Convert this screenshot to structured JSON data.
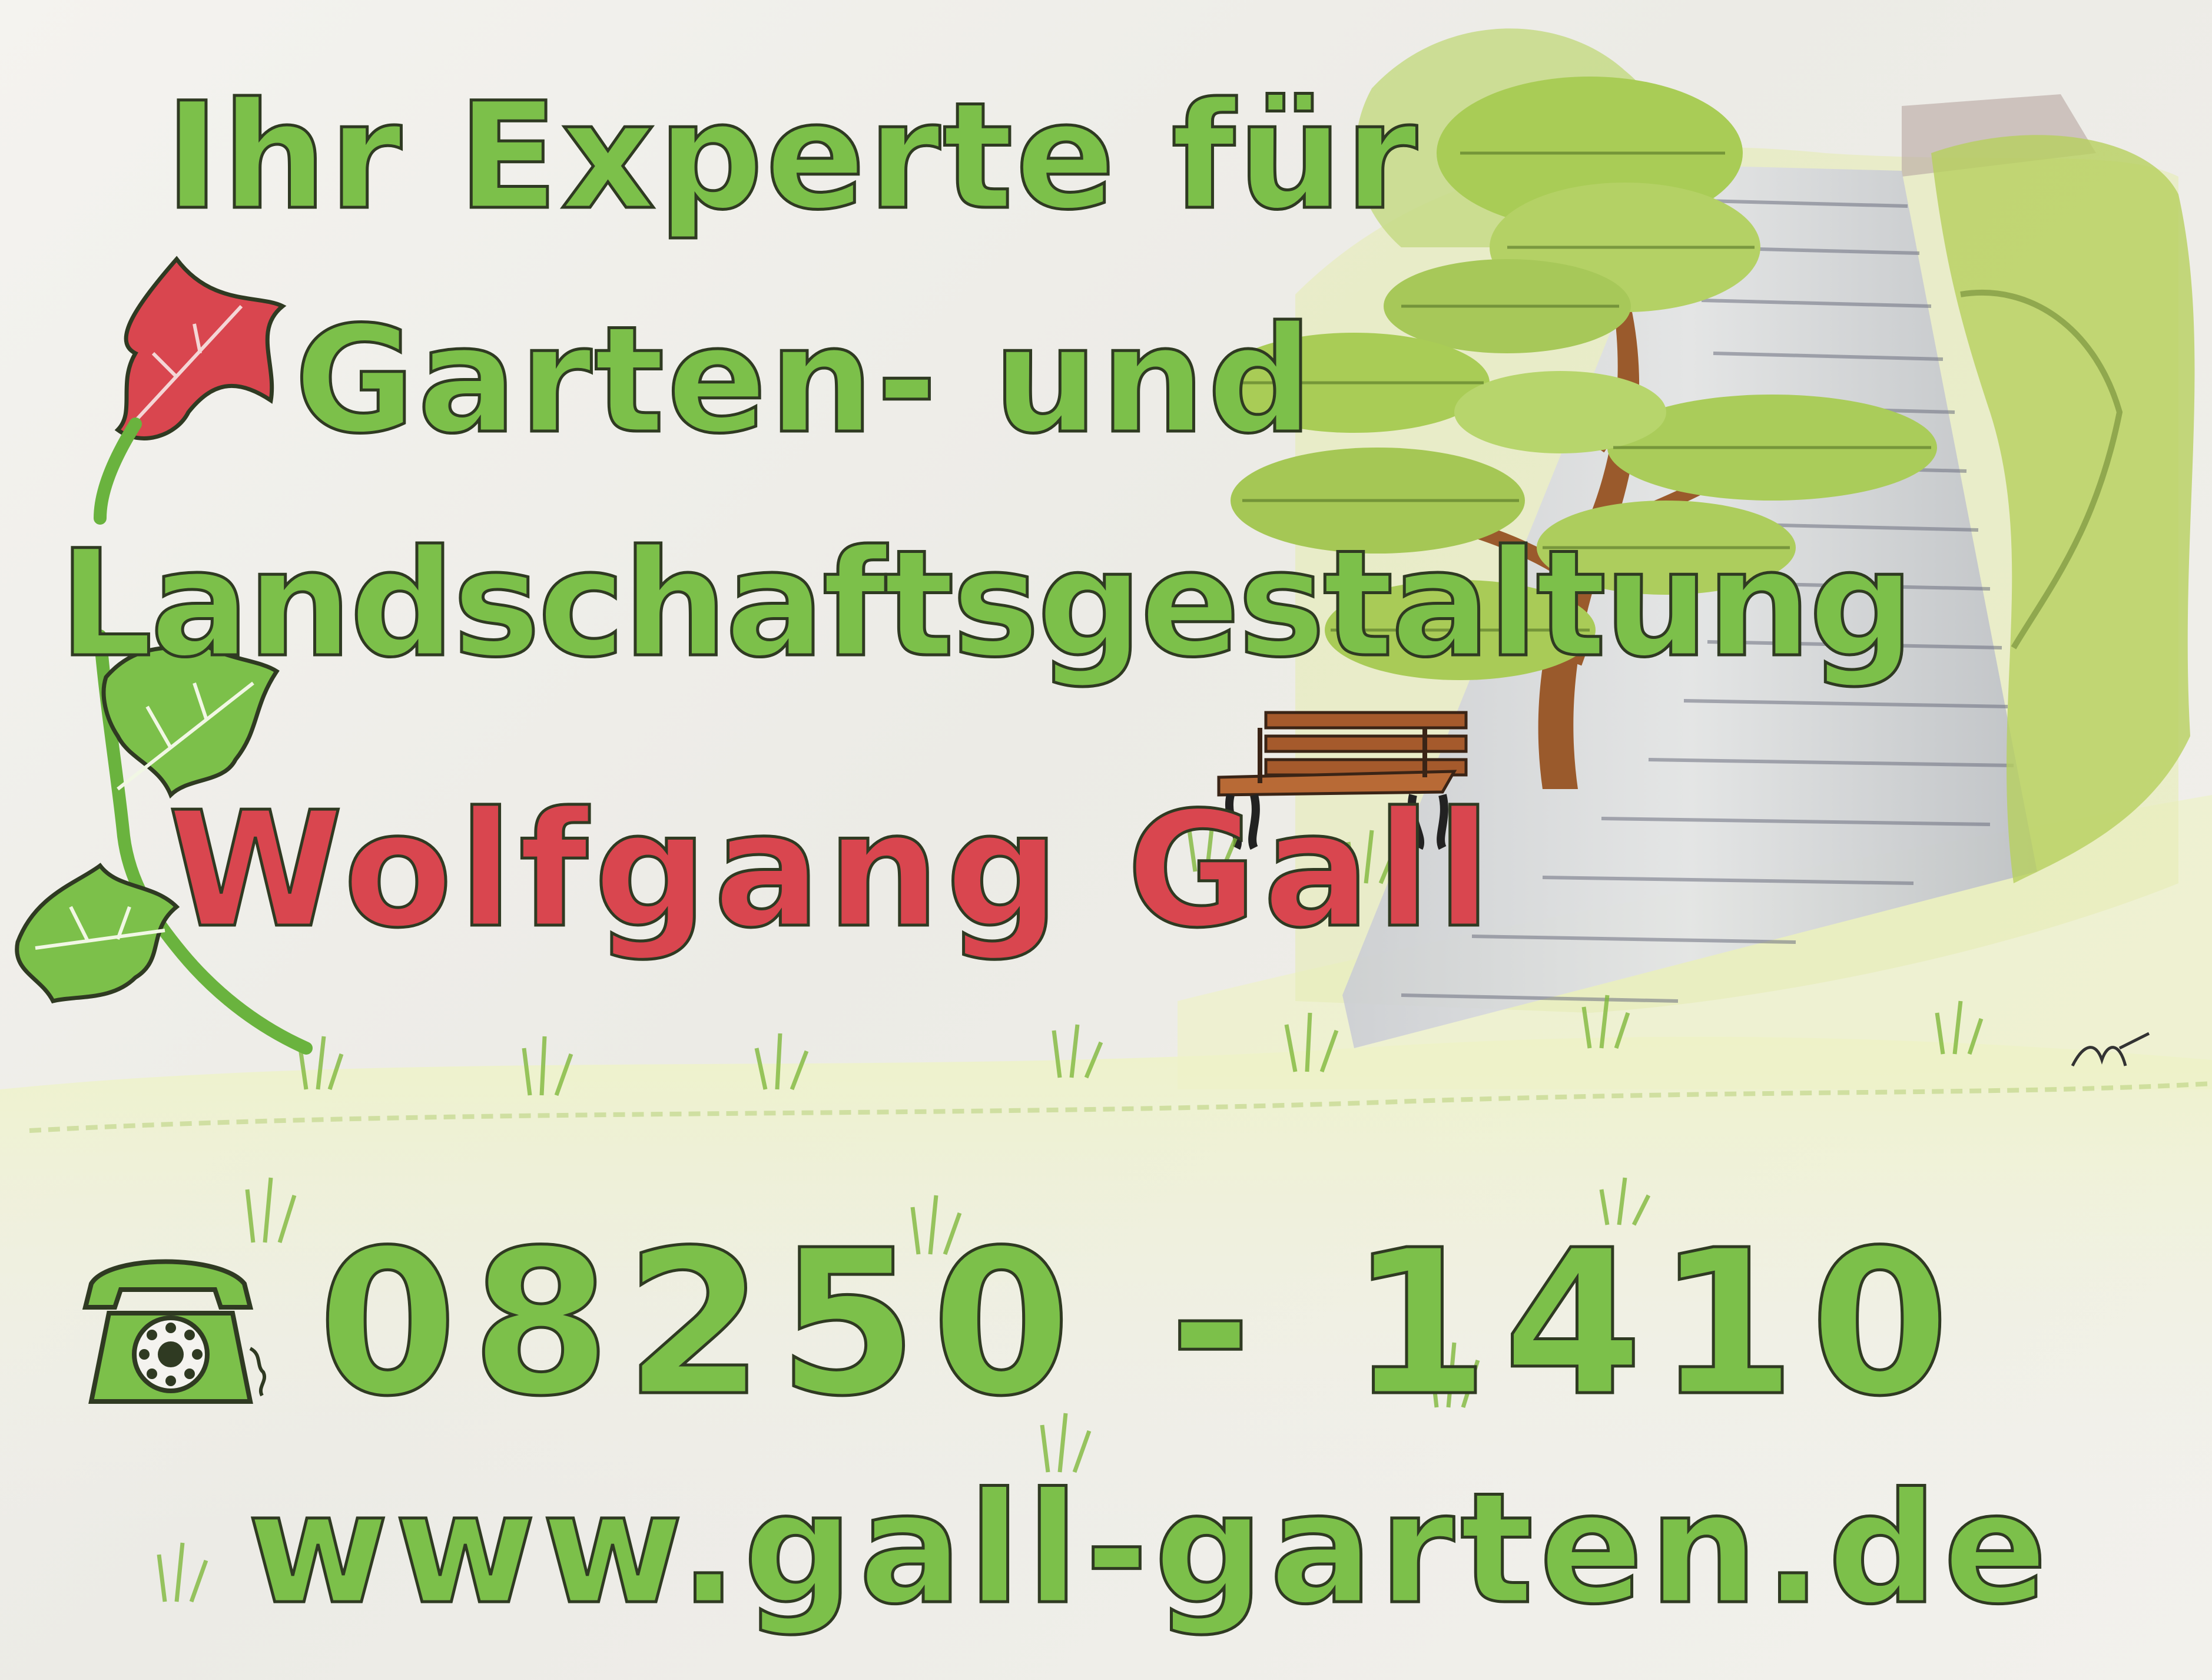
{
  "poster": {
    "headline_line1": "Ihr Experte für",
    "headline_line2": "Garten- und",
    "headline_line3": "Landschaftsgestaltung",
    "owner_name": "Wolfgang Gall",
    "phone_number": "08250 - 1410",
    "website": "www.gall-garten.de",
    "icons": [
      "rotary-telephone-icon",
      "red-leaf-icon",
      "green-leaf-icon"
    ],
    "colors": {
      "text_green": "#7cc04a",
      "text_red": "#d9464f",
      "outline": "#2f3a22",
      "paper": "#efeeea"
    }
  }
}
